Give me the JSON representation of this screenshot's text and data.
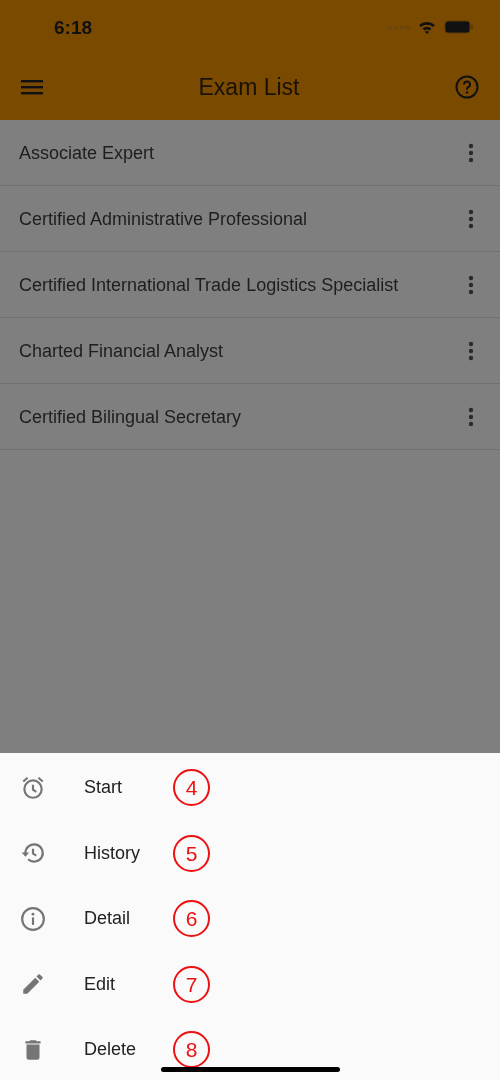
{
  "status_bar": {
    "time": "6:18"
  },
  "app_bar": {
    "title": "Exam List"
  },
  "exams": [
    {
      "name": "Associate Expert"
    },
    {
      "name": "Certified Administrative Professional"
    },
    {
      "name": "Certified International Trade Logistics Specialist"
    },
    {
      "name": "Charted Financial Analyst"
    },
    {
      "name": "Certified Bilingual Secretary"
    }
  ],
  "action_sheet": {
    "items": [
      {
        "kind": "alarm",
        "label": "Start",
        "annotation": "4"
      },
      {
        "kind": "history",
        "label": "History",
        "annotation": "5"
      },
      {
        "kind": "info",
        "label": "Detail",
        "annotation": "6"
      },
      {
        "kind": "edit",
        "label": "Edit",
        "annotation": "7"
      },
      {
        "kind": "delete",
        "label": "Delete",
        "annotation": "8"
      }
    ]
  }
}
